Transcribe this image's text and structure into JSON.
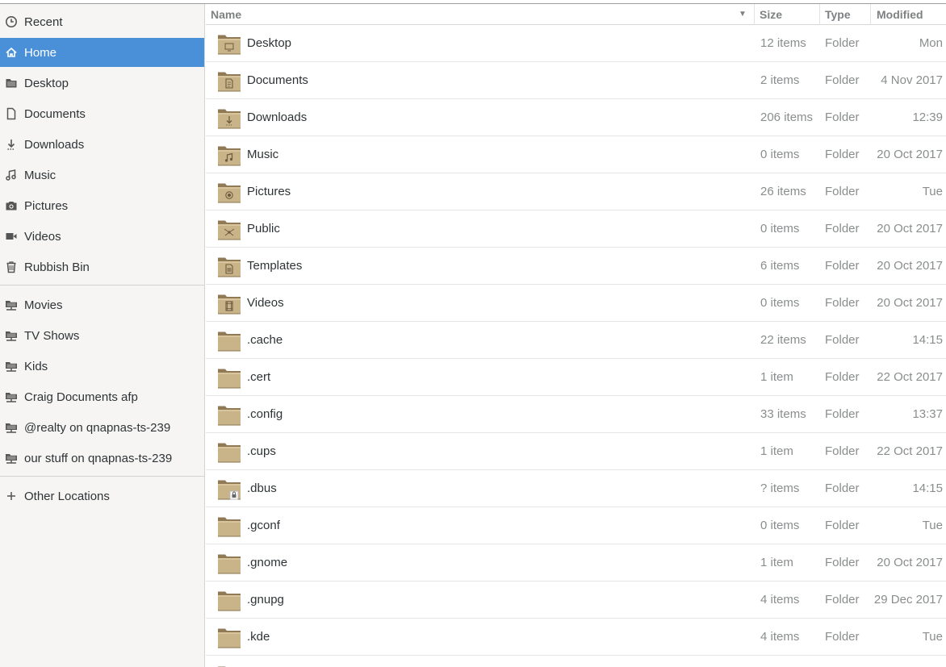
{
  "sidebar": {
    "places": [
      {
        "label": "Recent",
        "icon": "clock-icon"
      },
      {
        "label": "Home",
        "icon": "home-icon",
        "active": true
      },
      {
        "label": "Desktop",
        "icon": "folder-icon"
      },
      {
        "label": "Documents",
        "icon": "document-icon"
      },
      {
        "label": "Downloads",
        "icon": "download-icon"
      },
      {
        "label": "Music",
        "icon": "music-icon"
      },
      {
        "label": "Pictures",
        "icon": "camera-icon"
      },
      {
        "label": "Videos",
        "icon": "video-icon"
      },
      {
        "label": "Rubbish Bin",
        "icon": "trash-icon"
      }
    ],
    "network": [
      {
        "label": "Movies",
        "icon": "network-share-icon"
      },
      {
        "label": "TV Shows",
        "icon": "network-share-icon"
      },
      {
        "label": "Kids",
        "icon": "network-share-icon"
      },
      {
        "label": "Craig Documents afp",
        "icon": "network-share-icon"
      },
      {
        "label": "@realty on qnapnas-ts-239",
        "icon": "network-share-icon"
      },
      {
        "label": "our stuff on qnapnas-ts-239",
        "icon": "network-share-icon"
      }
    ],
    "other": {
      "label": "Other Locations",
      "icon": "plus-icon"
    },
    "accent": "#4a90d9"
  },
  "header": {
    "name": "Name",
    "size": "Size",
    "type": "Type",
    "modified": "Modified"
  },
  "files": [
    {
      "name": "Desktop",
      "size": "12 items",
      "type": "Folder",
      "modified": "Mon",
      "emblem": "desktop"
    },
    {
      "name": "Documents",
      "size": "2 items",
      "type": "Folder",
      "modified": "4 Nov 2017",
      "emblem": "documents"
    },
    {
      "name": "Downloads",
      "size": "206 items",
      "type": "Folder",
      "modified": "12:39",
      "emblem": "downloads"
    },
    {
      "name": "Music",
      "size": "0 items",
      "type": "Folder",
      "modified": "20 Oct 2017",
      "emblem": "music"
    },
    {
      "name": "Pictures",
      "size": "26 items",
      "type": "Folder",
      "modified": "Tue",
      "emblem": "pictures"
    },
    {
      "name": "Public",
      "size": "0 items",
      "type": "Folder",
      "modified": "20 Oct 2017",
      "emblem": "public"
    },
    {
      "name": "Templates",
      "size": "6 items",
      "type": "Folder",
      "modified": "20 Oct 2017",
      "emblem": "templates"
    },
    {
      "name": "Videos",
      "size": "0 items",
      "type": "Folder",
      "modified": "20 Oct 2017",
      "emblem": "videos"
    },
    {
      "name": ".cache",
      "size": "22 items",
      "type": "Folder",
      "modified": "14:15",
      "emblem": "none"
    },
    {
      "name": ".cert",
      "size": "1 item",
      "type": "Folder",
      "modified": "22 Oct 2017",
      "emblem": "none"
    },
    {
      "name": ".config",
      "size": "33 items",
      "type": "Folder",
      "modified": "13:37",
      "emblem": "none"
    },
    {
      "name": ".cups",
      "size": "1 item",
      "type": "Folder",
      "modified": "22 Oct 2017",
      "emblem": "none"
    },
    {
      "name": ".dbus",
      "size": "? items",
      "type": "Folder",
      "modified": "14:15",
      "emblem": "lock"
    },
    {
      "name": ".gconf",
      "size": "0 items",
      "type": "Folder",
      "modified": "Tue",
      "emblem": "none"
    },
    {
      "name": ".gnome",
      "size": "1 item",
      "type": "Folder",
      "modified": "20 Oct 2017",
      "emblem": "none"
    },
    {
      "name": ".gnupg",
      "size": "4 items",
      "type": "Folder",
      "modified": "29 Dec 2017",
      "emblem": "none"
    },
    {
      "name": ".kde",
      "size": "4 items",
      "type": "Folder",
      "modified": "Tue",
      "emblem": "none"
    }
  ]
}
